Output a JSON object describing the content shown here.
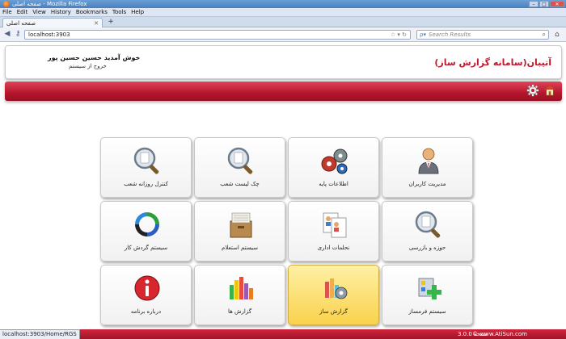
{
  "browser": {
    "window_title": "صفحه اصلی - Mozilla Firefox",
    "menu": [
      "File",
      "Edit",
      "View",
      "History",
      "Bookmarks",
      "Tools",
      "Help"
    ],
    "tab_title": "صفحه اصلی",
    "url": "localhost:3903",
    "search_placeholder": "Search Results",
    "status_url": "localhost:3903/Home/RGS"
  },
  "header": {
    "welcome": "خوش آمدید حسین حسین پور",
    "logout": "خروج از سیستم",
    "app_title": "آتیبان(سامانه گزارش ساز)"
  },
  "tiles": [
    {
      "label": "مدیریت کاربران",
      "icon": "user-icon"
    },
    {
      "label": "اطلاعات پایه",
      "icon": "gears-icon"
    },
    {
      "label": "چک لیست شعب",
      "icon": "magnifier-icon"
    },
    {
      "label": "کنترل روزانه شعب",
      "icon": "magnifier-icon"
    },
    {
      "label": "حوزه و بازرسی",
      "icon": "magnifier-icon"
    },
    {
      "label": "نحلمات اداری",
      "icon": "documents-icon"
    },
    {
      "label": "سیستم استعلام",
      "icon": "filebox-icon"
    },
    {
      "label": "سیستم گردش کار",
      "icon": "cycle-icon"
    },
    {
      "label": "سیستم فرمساز",
      "icon": "form-builder-icon"
    },
    {
      "label": "گزارش ساز",
      "icon": "report-builder-icon"
    },
    {
      "label": "گزارش ها",
      "icon": "bar-chart-icon"
    },
    {
      "label": "درباره برنامه",
      "icon": "info-icon"
    }
  ],
  "footer": {
    "version": "3.0.0 نسخه",
    "copyright": "© www.AtiSun.com"
  },
  "colors": {
    "brand_red": "#c0172d",
    "active_tile": "#f9d24c"
  }
}
